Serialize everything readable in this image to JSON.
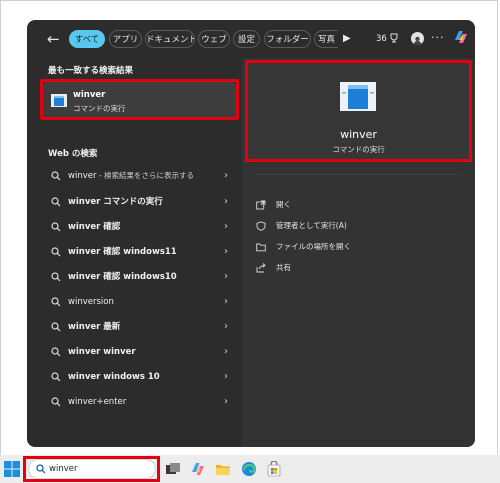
{
  "filters": {
    "back": "←",
    "pills": [
      "すべて",
      "アプリ",
      "ドキュメント",
      "ウェブ",
      "設定",
      "フォルダー",
      "写真"
    ],
    "active": "すべて",
    "more": "▶",
    "count": "36",
    "menu": "···"
  },
  "best_match": {
    "heading": "最も一致する検索結果",
    "name": "winver",
    "subtitle": "コマンドの実行"
  },
  "web": {
    "heading": "Web の検索",
    "items": [
      {
        "query": "winver",
        "suffix": " - 検索結果をさらに表示する"
      },
      {
        "query": "winver コマンドの実行",
        "suffix": ""
      },
      {
        "query": "winver 確認",
        "suffix": ""
      },
      {
        "query": "winver 確認 windows11",
        "suffix": ""
      },
      {
        "query": "winver 確認 windows10",
        "suffix": ""
      },
      {
        "query": "winversion",
        "suffix": ""
      },
      {
        "query": "winver 最新",
        "suffix": ""
      },
      {
        "query": "winver winver",
        "suffix": ""
      },
      {
        "query": "winver windows 10",
        "suffix": ""
      },
      {
        "query": "winver+enter",
        "suffix": ""
      }
    ],
    "chevron": "›"
  },
  "preview": {
    "name": "winver",
    "subtitle": "コマンドの実行",
    "actions": [
      {
        "label": "開く",
        "icon": "open-icon"
      },
      {
        "label": "管理者として実行(A)",
        "icon": "shield-icon"
      },
      {
        "label": "ファイルの場所を開く",
        "icon": "folder-icon"
      },
      {
        "label": "共有",
        "icon": "share-icon"
      }
    ]
  },
  "taskbar": {
    "search_value": "winver"
  },
  "colors": {
    "accent": "#5ac8ee",
    "highlight": "#e3000f",
    "panel": "#2c2c2c"
  }
}
